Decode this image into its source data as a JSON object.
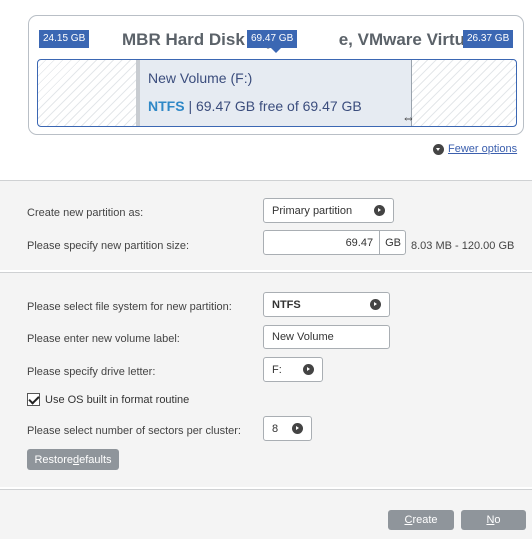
{
  "disk": {
    "title": "MBR Hard Disk 3 (VMware, VMware Virtual S",
    "title_visible_left": "MBR Hard Disk 3 (V",
    "title_visible_right": "e, VMware Virtual S",
    "unallocated_before": "24.15 GB",
    "new_partition_size": "69.47 GB",
    "unallocated_after": "26.37 GB",
    "volume_name": "New Volume (F:)",
    "volume_fs": "NTFS",
    "volume_separator": " | ",
    "volume_free": "69.47 GB free of 69.47 GB",
    "resize_symbol": "⇔"
  },
  "toggle": {
    "fewer_options": "Fewer options"
  },
  "form": {
    "partition_type_label": "Create new partition as:",
    "partition_type_value": "Primary partition",
    "size_label": "Please specify new partition size:",
    "size_value": "69.47",
    "size_unit": "GB",
    "size_range": "8.03 MB - 120.00 GB",
    "fs_label": "Please select file system for new partition:",
    "fs_value": "NTFS",
    "volume_label_label": "Please enter new volume label:",
    "volume_label_value": "New Volume",
    "drive_letter_label": "Please specify drive letter:",
    "drive_letter_value": "F:",
    "use_os_format_label": "Use OS built in format routine",
    "use_os_format_checked": true,
    "sectors_label": "Please select number of sectors per cluster:",
    "sectors_value": "8",
    "restore_defaults_prefix": "Restore ",
    "restore_defaults_underlined": "d",
    "restore_defaults_suffix": "efaults"
  },
  "footer": {
    "create_underlined": "C",
    "create_rest": "reate",
    "no_underlined": "N",
    "no_rest": "o"
  },
  "colors": {
    "accent_blue": "#3b67b3",
    "fs_text": "#2f88c7",
    "button_gray": "#8f959b",
    "panel_bg": "#f4f4f4"
  }
}
